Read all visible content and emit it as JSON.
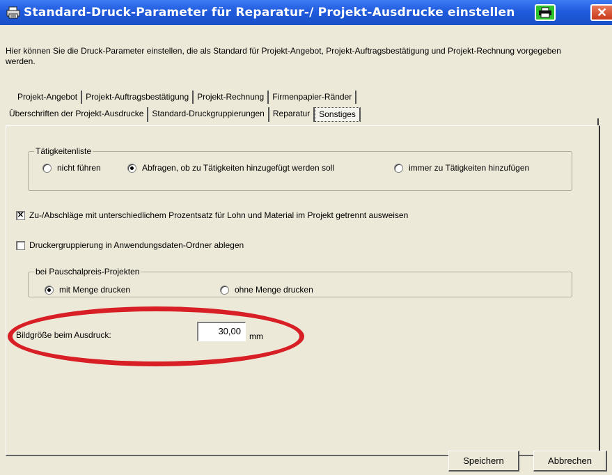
{
  "window": {
    "title": "Standard-Druck-Parameter für Reparatur-/ Projekt-Ausdrucke einstellen",
    "close_glyph": "✕"
  },
  "intro": "Hier können Sie die Druck-Parameter einstellen, die als Standard für Projekt-Angebot, Projekt-Auftragsbestätigung und Projekt-Rechnung vorgegeben werden.",
  "tabs": {
    "row1": [
      "Projekt-Angebot",
      "Projekt-Auftragsbestätigung",
      "Projekt-Rechnung",
      "Firmenpapier-Ränder"
    ],
    "row2": [
      "Überschriften der Projekt-Ausdrucke",
      "Standard-Druckgruppierungen",
      "Reparatur",
      "Sonstiges"
    ],
    "selected": "Sonstiges"
  },
  "taetigkeiten": {
    "legend": "Tätigkeitenliste",
    "options": [
      "nicht führen",
      "Abfragen, ob zu Tätigkeiten hinzugefügt werden soll",
      "immer zu Tätigkeiten hinzufügen"
    ],
    "selected_index": 1
  },
  "checkbox_zuabschlaege": {
    "label": "Zu-/Abschläge mit unterschiedlichem Prozentsatz für Lohn und Material im Projekt getrennt ausweisen",
    "checked": true,
    "mark": "✕"
  },
  "checkbox_druckergruppierung": {
    "label": "Druckergruppierung in Anwendungsdaten-Ordner ablegen",
    "checked": false
  },
  "pauschalpreis": {
    "legend": "bei Pauschalpreis-Projekten",
    "options": [
      "mit Menge drucken",
      "ohne Menge drucken"
    ],
    "selected_index": 0
  },
  "bildgroesse": {
    "label": "Bildgröße beim Ausdruck:",
    "value": "30,00",
    "unit": "mm"
  },
  "buttons": {
    "save": "Speichern",
    "cancel": "Abbrechen"
  },
  "colors": {
    "titlebar": "#1f5bdc",
    "face": "#ece9d8",
    "highlight_ellipse": "#d81f26",
    "print_button": "#2ec22e",
    "close_button": "#c9391b"
  }
}
